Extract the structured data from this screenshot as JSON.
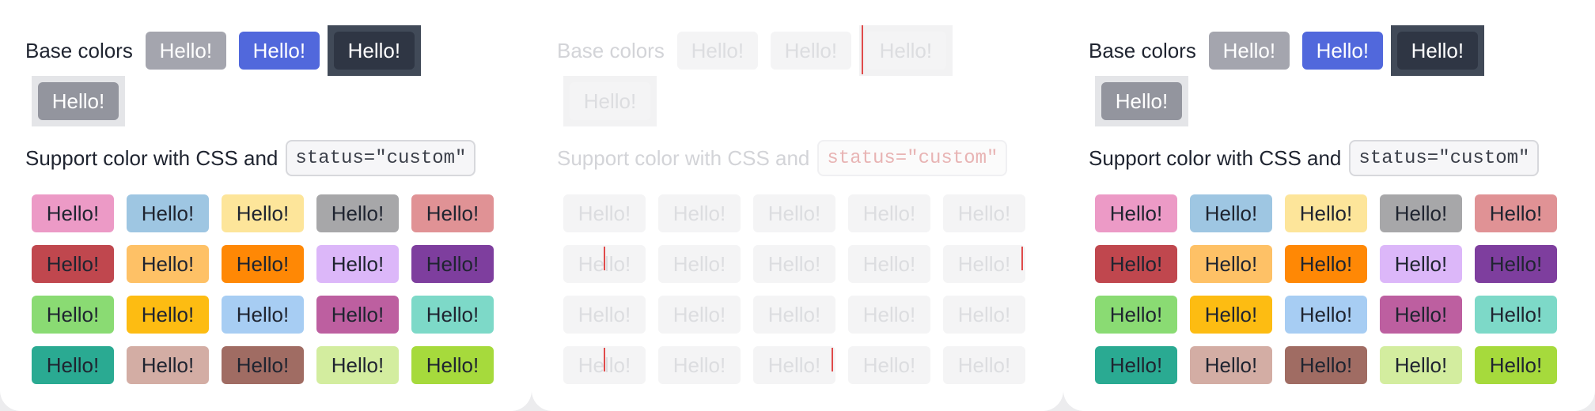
{
  "base_label": "Base colors",
  "support_label": "Support color with CSS and",
  "code_text": "status=\"custom\"",
  "button_text": "Hello!",
  "base_buttons": [
    {
      "bg": "#a4a5ae"
    },
    {
      "bg": "#5168dc"
    },
    {
      "bg": "#2f3644",
      "wrap": "#414a58"
    },
    {
      "bg": "#93959e",
      "wrap": "#e4e5e8"
    }
  ],
  "custom_colors": [
    "#ec9ac6",
    "#9ec6e2",
    "#fde59a",
    "#a7a7a9",
    "#e09295",
    "#c0474e",
    "#fec166",
    "#ff8805",
    "#dcb7f9",
    "#7e3e9e",
    "#8adb73",
    "#fdbc12",
    "#a7cdf3",
    "#bd5fa0",
    "#7dd9c8",
    "#2aaa92",
    "#d3ada4",
    "#a06c63",
    "#d3ed9f",
    "#a6da3c"
  ]
}
